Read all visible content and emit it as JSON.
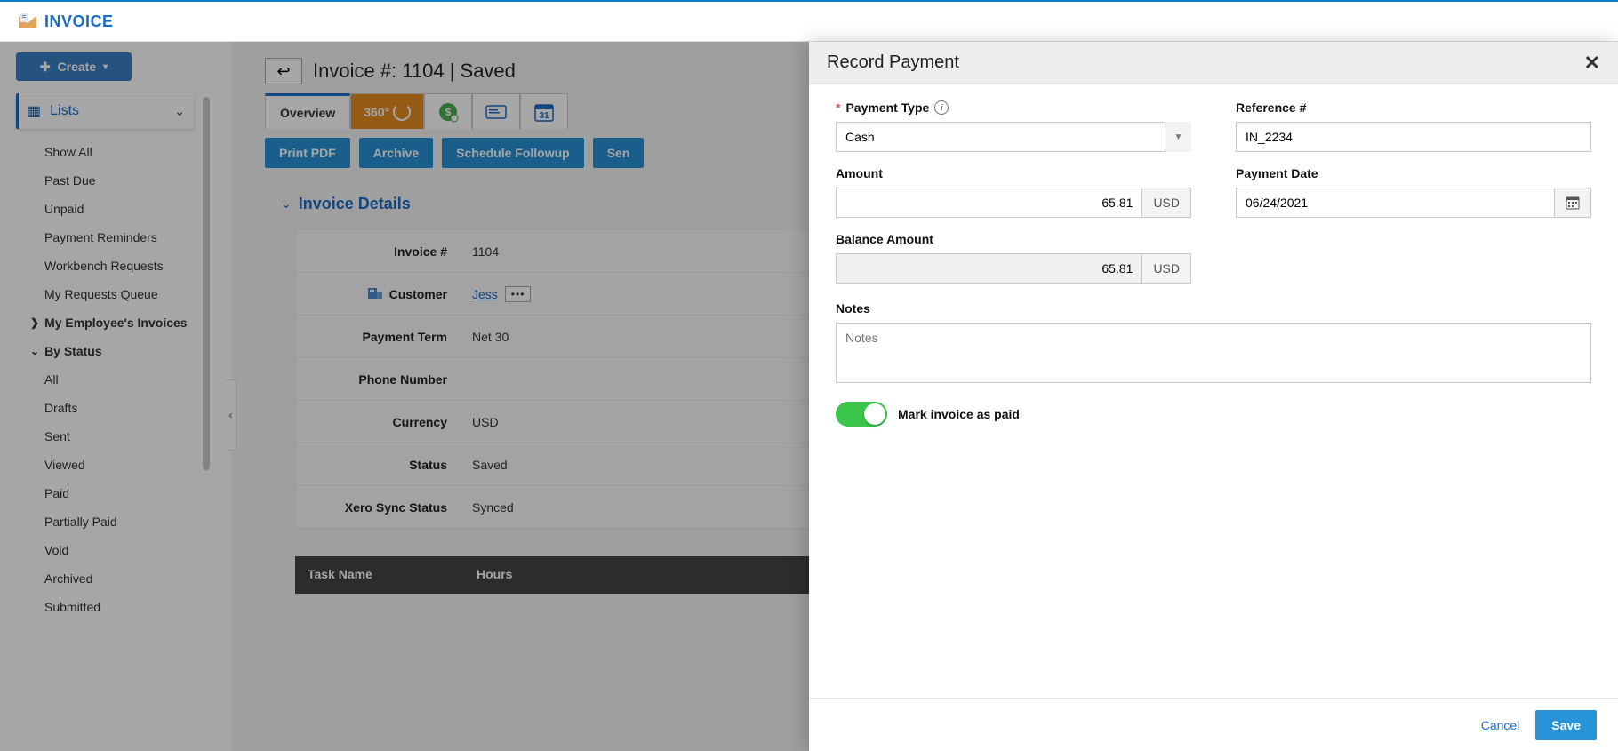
{
  "app": {
    "title": "INVOICE"
  },
  "sidebar": {
    "create_label": "Create",
    "lists_label": "Lists",
    "items": [
      "Show All",
      "Past Due",
      "Unpaid",
      "Payment Reminders",
      "Workbench Requests",
      "My Requests Queue"
    ],
    "group1_label": "My Employee's Invoices",
    "group2_label": "By Status",
    "status_items": [
      "All",
      "Drafts",
      "Sent",
      "Viewed",
      "Paid",
      "Partially Paid",
      "Void",
      "Archived",
      "Submitted"
    ]
  },
  "content": {
    "page_title": "Invoice #: 1104 | Saved",
    "tabs": {
      "overview": "Overview",
      "t360": "360"
    },
    "actions": {
      "print_pdf": "Print PDF",
      "archive": "Archive",
      "schedule_followup": "Schedule Followup",
      "send": "Sen"
    },
    "section_title": "Invoice Details",
    "details": {
      "labels": {
        "invoice_no": "Invoice #",
        "customer": "Customer",
        "payment_term": "Payment Term",
        "phone": "Phone Number",
        "currency": "Currency",
        "status": "Status",
        "xero": "Xero Sync Status"
      },
      "values": {
        "invoice_no": "1104",
        "customer": "Jess",
        "payment_term": "Net 30",
        "phone": "",
        "currency": "USD",
        "status": "Saved",
        "xero": "Synced"
      }
    },
    "table": {
      "h1": "Task Name",
      "h2": "Hours"
    }
  },
  "modal": {
    "title": "Record Payment",
    "payment_type": {
      "label": "Payment Type",
      "value": "Cash"
    },
    "reference": {
      "label": "Reference #",
      "value": "IN_2234"
    },
    "amount": {
      "label": "Amount",
      "value": "65.81",
      "currency": "USD"
    },
    "payment_date": {
      "label": "Payment Date",
      "value": "06/24/2021"
    },
    "balance": {
      "label": "Balance Amount",
      "value": "65.81",
      "currency": "USD"
    },
    "notes": {
      "label": "Notes",
      "placeholder": "Notes"
    },
    "mark_paid_label": "Mark invoice as paid",
    "cancel": "Cancel",
    "save": "Save"
  }
}
